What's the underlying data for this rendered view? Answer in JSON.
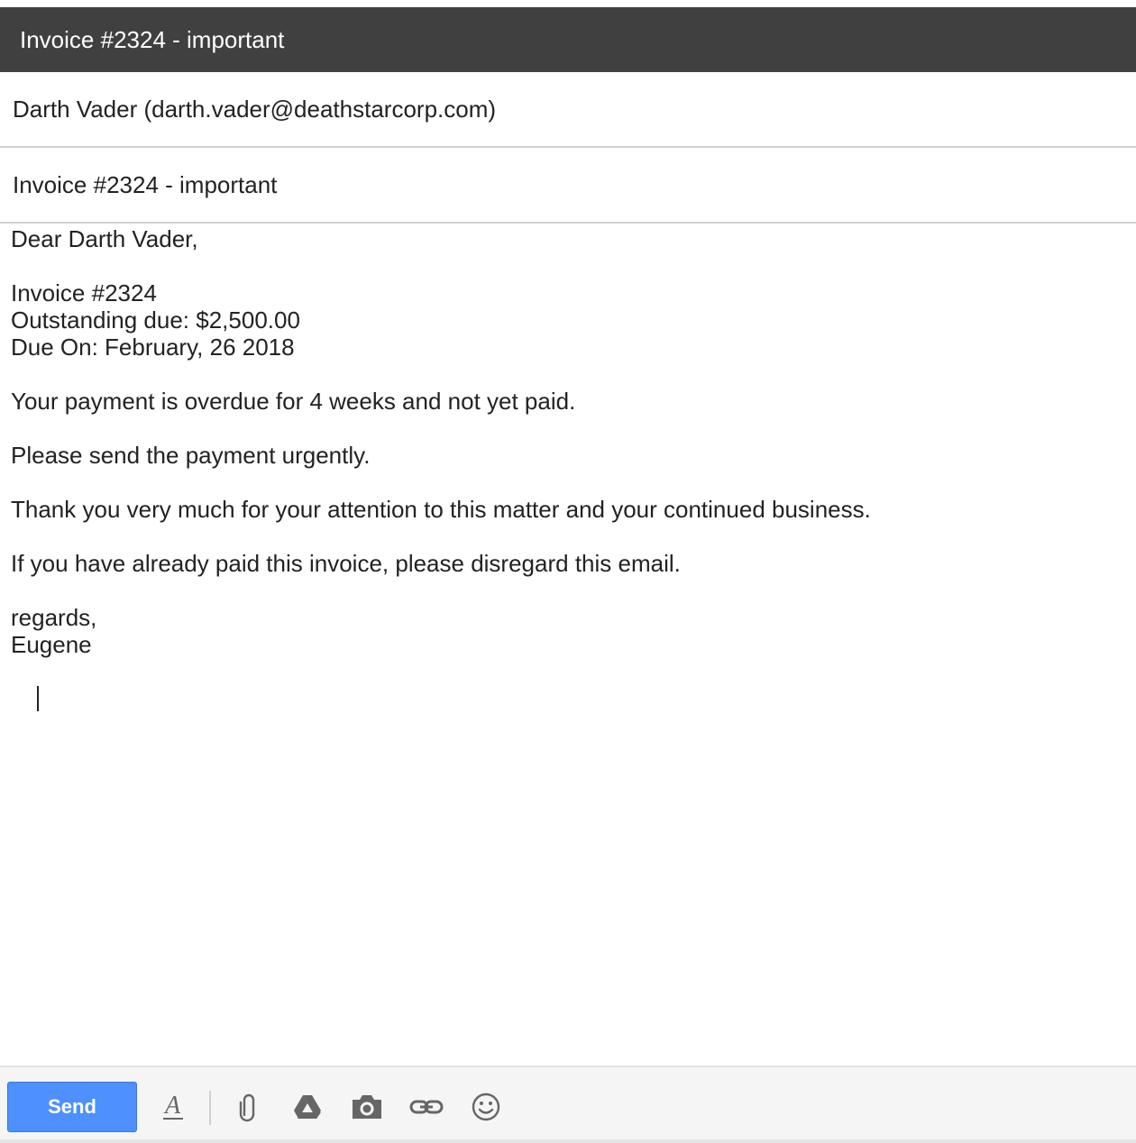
{
  "window": {
    "title": "Invoice #2324 - important"
  },
  "compose": {
    "to": "Darth Vader (darth.vader@deathstarcorp.com)",
    "subject": "Invoice #2324 - important",
    "body_lines": [
      "Dear Darth Vader,",
      "",
      "Invoice #2324",
      "Outstanding due: $2,500.00",
      "Due On: February, 26 2018",
      "",
      "Your payment is overdue for 4 weeks and not yet paid.",
      "",
      "Please send the payment urgently.",
      "",
      "Thank you very much for your attention to this matter and your continued business.",
      "",
      "If you have already paid this invoice, please disregard this email.",
      "",
      "regards,",
      "Eugene"
    ]
  },
  "toolbar": {
    "send_label": "Send",
    "tools": [
      "formatting-icon",
      "attachment-icon",
      "drive-icon",
      "camera-icon",
      "link-icon",
      "emoji-icon"
    ]
  },
  "colors": {
    "titlebar": "#404040",
    "send_button": "#4d90fe",
    "toolbar_bg": "#f5f5f5"
  }
}
